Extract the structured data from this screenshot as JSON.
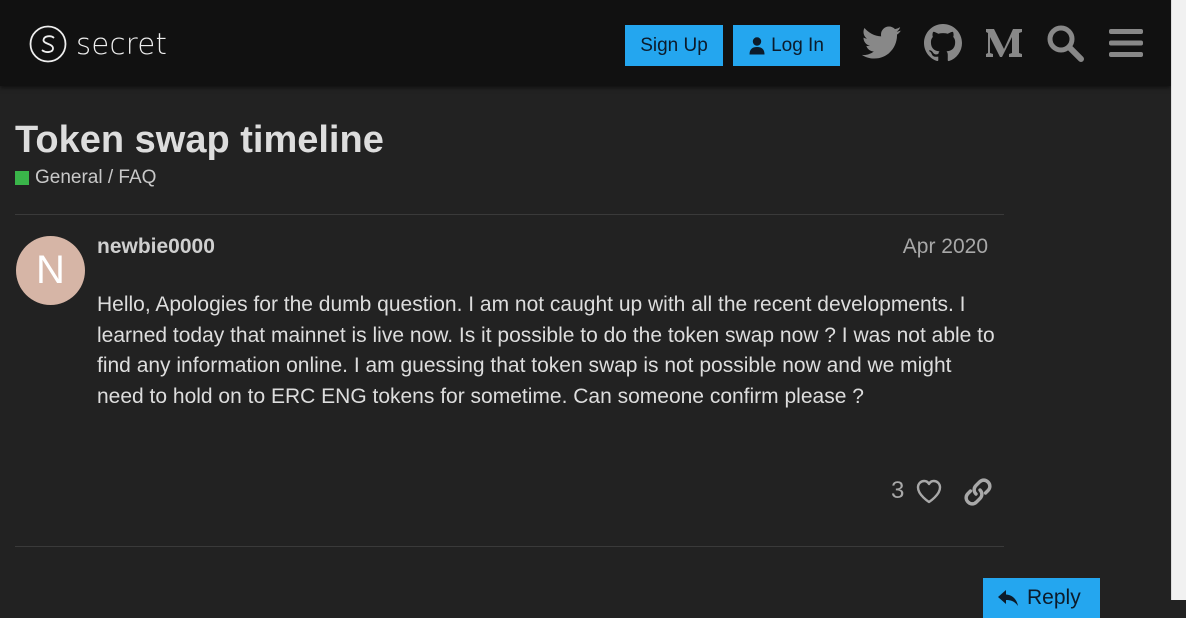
{
  "header": {
    "logo_text": "secret",
    "signup_label": "Sign Up",
    "login_label": "Log In",
    "icons": [
      "twitter-icon",
      "github-icon",
      "medium-icon",
      "search-icon",
      "menu-icon"
    ]
  },
  "topic": {
    "title": "Token swap timeline",
    "category": "General / FAQ",
    "category_color": "#3ab54a"
  },
  "post": {
    "avatar_letter": "N",
    "username": "newbie0000",
    "date": "Apr 2020",
    "body": "Hello, Apologies for the dumb question. I am not caught up with all the recent developments. I learned today that mainnet is live now. Is it possible to do the token swap now ? I was not able to find any information online. I am guessing that token swap is not possible now and we might need to hold on to ERC ENG tokens for sometime. Can someone confirm please ?",
    "like_count": "3"
  },
  "footer": {
    "reply_label": "Reply"
  },
  "colors": {
    "accent": "#24a6ef",
    "background": "#222222",
    "header": "#111111"
  }
}
